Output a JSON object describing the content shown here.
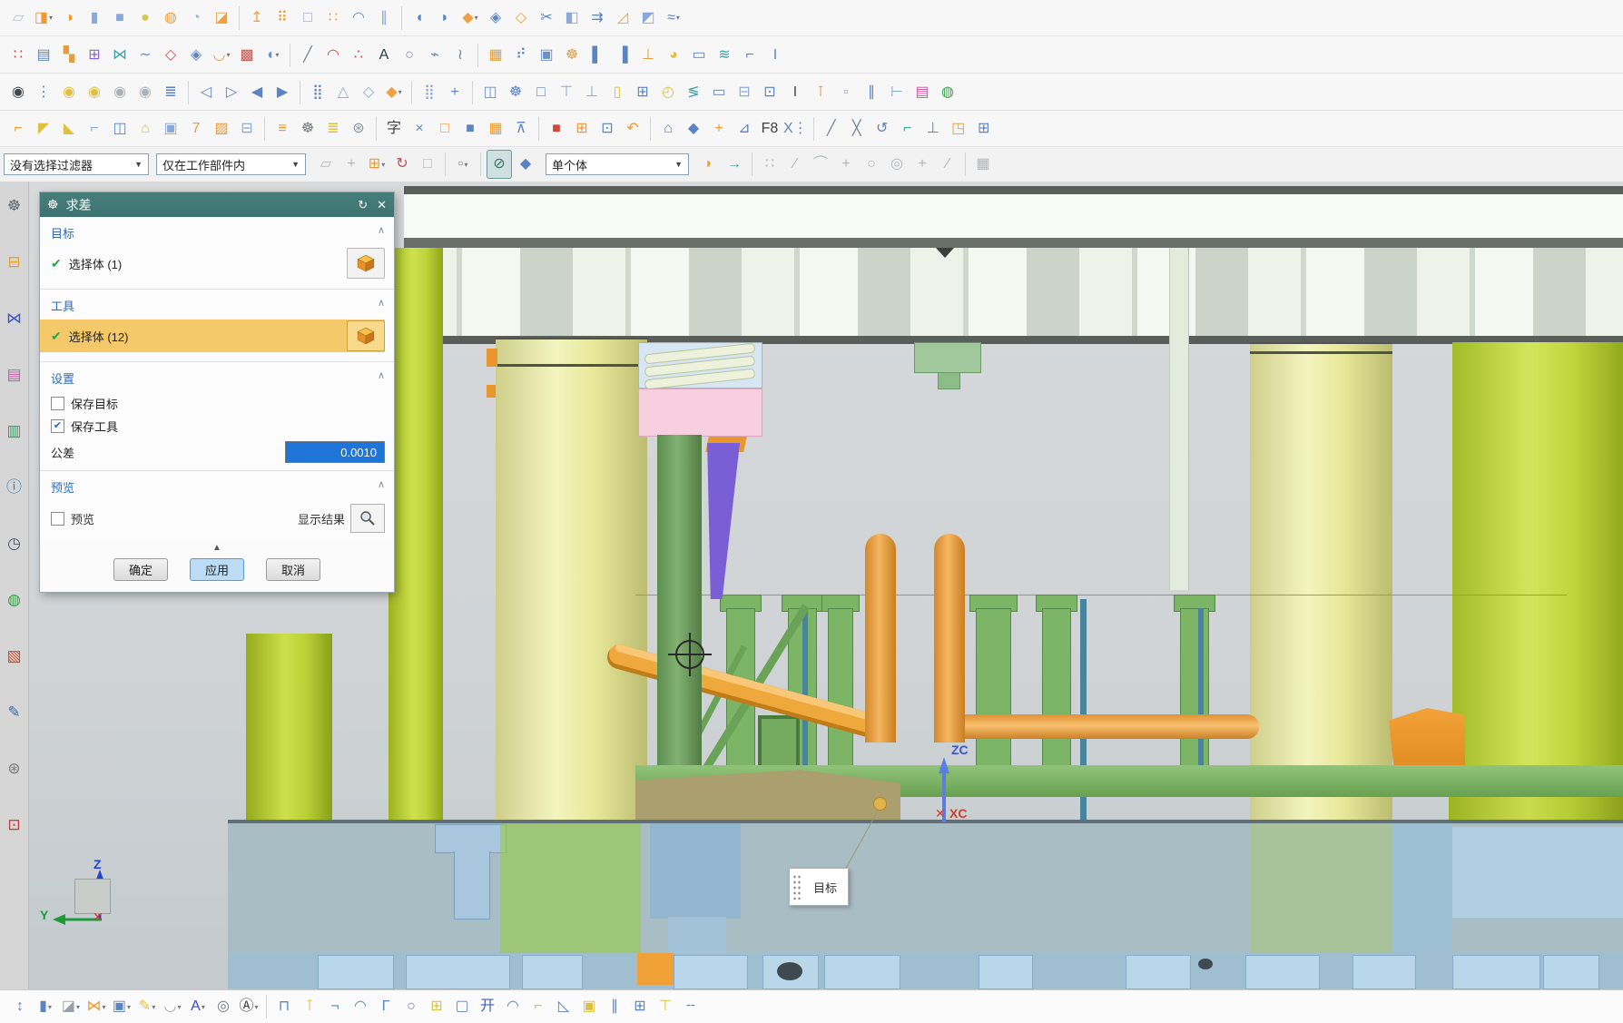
{
  "dialog": {
    "title": "求差",
    "target_section": {
      "label": "目标",
      "row_label": "选择体 (1)"
    },
    "tool_section": {
      "label": "工具",
      "row_label": "选择体 (12)"
    },
    "settings_section": {
      "label": "设置",
      "save_target_label": "保存目标",
      "save_target_checked": false,
      "save_tool_label": "保存工具",
      "save_tool_checked": true,
      "tolerance_label": "公差",
      "tolerance_value": "0.0010"
    },
    "preview_section": {
      "label": "预览",
      "preview_label": "预览",
      "preview_checked": false,
      "show_result_label": "显示结果"
    },
    "buttons": {
      "ok": "确定",
      "apply": "应用",
      "cancel": "取消"
    },
    "collapse_glyph": "▲"
  },
  "filter_bar": {
    "selection_filter": "没有选择过滤器",
    "scope": "仅在工作部件内",
    "body_rule": "单个体",
    "mid_icons": [
      [
        "ghost-select",
        "▱",
        "#b6bcc0"
      ],
      [
        "general-pick",
        "+",
        "#b0b6ba"
      ],
      [
        "point-snap",
        "⊞",
        "#e89a30",
        1
      ],
      [
        "rotate-pick",
        "↻",
        "#c05050"
      ],
      [
        "quick-pick",
        "□",
        "#b0b6ba"
      ],
      "|",
      [
        "marquee-select",
        "▫",
        "#8a9096",
        1
      ],
      "|",
      [
        "clip-section",
        "⊘",
        "#3f6a68",
        2
      ],
      [
        "shaded-body",
        "◆",
        "#5b84c4"
      ]
    ],
    "right_icons": [
      [
        "region-fan",
        "◗",
        "#f0a030"
      ],
      [
        "go-forward",
        "→",
        "#3fa0a8"
      ],
      "|",
      [
        "snap-point",
        "∷",
        "#b0b6ba"
      ],
      [
        "snap-end",
        "∕",
        "#b0b6ba"
      ],
      [
        "snap-mid",
        "⌒",
        "#b0b6ba"
      ],
      [
        "snap-cross",
        "+",
        "#b0b6ba"
      ],
      [
        "snap-circle",
        "○",
        "#b0b6ba"
      ],
      [
        "snap-center",
        "◎",
        "#b0b6ba"
      ],
      [
        "snap-plus",
        "+",
        "#b0b6ba"
      ],
      [
        "snap-slope",
        "∕",
        "#b0b6ba"
      ],
      "|",
      [
        "grid-snap",
        "▦",
        "#b0b6ba"
      ]
    ]
  },
  "toolbars": {
    "row1": [
      [
        "sketch",
        "▱",
        "#b8c4cc"
      ],
      [
        "extrude",
        "◨",
        "#f09a30",
        1
      ],
      [
        "revolve",
        "◑",
        "#f09a30"
      ],
      [
        "cylinder",
        "▮",
        "#8aa8d8"
      ],
      [
        "block",
        "■",
        "#8aa8d8"
      ],
      [
        "sphere",
        "●",
        "#d4c84e"
      ],
      [
        "boss",
        "◍",
        "#f0a040"
      ],
      [
        "pad",
        "◔",
        "#98b4dc"
      ],
      [
        "emboss",
        "◪",
        "#f0a040"
      ],
      "|",
      [
        "datum-plane",
        "↥",
        "#f0a040"
      ],
      [
        "pattern-feature",
        "⠿",
        "#f09a30"
      ],
      [
        "bounded-body",
        "□",
        "#8aa8d8"
      ],
      [
        "scatter-points",
        "∷",
        "#f09a30"
      ],
      [
        "swept",
        "◠",
        "#6a90cc"
      ],
      [
        "tube",
        "∥",
        "#8aa8d8"
      ],
      "|",
      [
        "page-left",
        "◖",
        "#5b84c4"
      ],
      [
        "page-right",
        "◗",
        "#5b84c4"
      ],
      [
        "unite",
        "◆",
        "#f0a040",
        1
      ],
      [
        "subtract-tool",
        "◈",
        "#5b84c4"
      ],
      [
        "intersect",
        "◇",
        "#f0a040"
      ],
      [
        "trim-body",
        "✂",
        "#5b84c4"
      ],
      [
        "split-body",
        "◧",
        "#8aa8d8"
      ],
      [
        "offset-face",
        "⇉",
        "#5b84c4"
      ],
      [
        "draft",
        "◿",
        "#f0a040"
      ],
      [
        "shell",
        "◩",
        "#8aa8d8"
      ],
      [
        "thread",
        "≈",
        "#5b84c4",
        1
      ]
    ],
    "row2": [
      [
        "mesh-points",
        "∷",
        "#d05048"
      ],
      [
        "pocket",
        "▤",
        "#5b84c4"
      ],
      [
        "pad-table",
        "▚",
        "#e0a040"
      ],
      [
        "datum-csys",
        "⊞",
        "#8868c8"
      ],
      [
        "mirror-geom",
        "⋈",
        "#3fa0a8"
      ],
      [
        "ruled",
        "∼",
        "#6a90cc"
      ],
      [
        "bounded-plane",
        "◇",
        "#d05048"
      ],
      [
        "curve-mesh",
        "◈",
        "#5b84c4"
      ],
      [
        "sew",
        "◡",
        "#e0a040",
        1
      ],
      [
        "patch-body",
        "▩",
        "#d05048"
      ],
      [
        "wrap-geom",
        "◖",
        "#6a90cc",
        1
      ],
      "|",
      [
        "line",
        "╱",
        "#708090"
      ],
      [
        "arc",
        "◠",
        "#d05048"
      ],
      [
        "point",
        "∴",
        "#d05048"
      ],
      [
        "text",
        "A",
        "#303848"
      ],
      [
        "ellipse",
        "○",
        "#6a90cc"
      ],
      [
        "helix",
        "⌁",
        "#5b84c4"
      ],
      [
        "law-curve",
        "≀",
        "#708090"
      ],
      "|",
      [
        "grid-pattern",
        "▦",
        "#e0a040"
      ],
      [
        "move-grid",
        "⠞",
        "#5b84c4"
      ],
      [
        "frame",
        "▣",
        "#6a90cc"
      ],
      [
        "gear-feature",
        "☸",
        "#e0a040"
      ],
      [
        "column-left",
        "▌",
        "#5b84c4"
      ],
      [
        "column-right",
        "▐",
        "#5b84c4"
      ],
      [
        "bolt-hole",
        "⊥",
        "#e0a040"
      ],
      [
        "pie-section",
        "◕",
        "#e0c040"
      ],
      [
        "slot",
        "▭",
        "#5b84c4"
      ],
      [
        "spring",
        "≋",
        "#3fa0a8"
      ],
      [
        "bracket",
        "⌐",
        "#5b84c4"
      ],
      [
        "i-beam",
        "I",
        "#5b84c4"
      ]
    ],
    "row3": [
      [
        "show-hide",
        "◉",
        "#404850"
      ],
      [
        "display-order",
        "⋮",
        "#5b84c4"
      ],
      [
        "highlight-on",
        "◉",
        "#e0c040"
      ],
      [
        "highlight-all",
        "◉",
        "#e0c040"
      ],
      [
        "dim-bulb",
        "◉",
        "#a8b0b8"
      ],
      [
        "dim-all",
        "◉",
        "#a8b0b8"
      ],
      [
        "layer-settings",
        "≣",
        "#5b84c4"
      ],
      "|",
      [
        "view-back",
        "◁",
        "#5b84c4"
      ],
      [
        "view-forward",
        "▷",
        "#5b84c4"
      ],
      [
        "view-first",
        "◀",
        "#5b84c4"
      ],
      [
        "view-last",
        "▶",
        "#5b84c4"
      ],
      "|",
      [
        "align-grid",
        "⣿",
        "#5b84c4"
      ],
      [
        "angle-snap",
        "△",
        "#8aa8d8"
      ],
      [
        "snap-open",
        "◇",
        "#8aa8d8"
      ],
      [
        "snap-solid",
        "◆",
        "#f0a040",
        1
      ],
      "|",
      [
        "point-grid",
        "⣿",
        "#8aa8d8"
      ],
      [
        "move-component",
        "+",
        "#5b84c4"
      ],
      "|",
      [
        "window-split",
        "◫",
        "#6a90cc"
      ],
      [
        "view-gear",
        "☸",
        "#5b84c4"
      ],
      [
        "fit-view",
        "□",
        "#5b84c4"
      ],
      [
        "top-align",
        "⊤",
        "#8aa8d8"
      ],
      [
        "bottom-align",
        "⊥",
        "#8aa8d8"
      ],
      [
        "cylinder-view",
        "▯",
        "#e0c040"
      ],
      [
        "table-view",
        "⊞",
        "#5b84c4"
      ],
      [
        "quadrant",
        "◴",
        "#e0c040"
      ],
      [
        "zigzag",
        "≶",
        "#3fa0a8"
      ],
      [
        "bar-note",
        "▭",
        "#5b84c4"
      ],
      [
        "equal-split",
        "⊟",
        "#8aa8d8"
      ],
      [
        "boxed",
        "⊡",
        "#5b84c4"
      ],
      [
        "italic-i",
        "I",
        "#404850"
      ],
      [
        "pin-top",
        "⊺",
        "#e0a040"
      ],
      [
        "small-square",
        "▫",
        "#8aa8d8"
      ],
      [
        "columns",
        "∥",
        "#5b84c4"
      ],
      [
        "tree-link",
        "⊢",
        "#8aa8d8"
      ],
      [
        "database",
        "▤",
        "#c858a8"
      ],
      [
        "globe-view",
        "◍",
        "#38a048"
      ]
    ],
    "row4": [
      [
        "corner-flange",
        "⌐",
        "#f09a30"
      ],
      [
        "finger-tab",
        "◤",
        "#e0c040"
      ],
      [
        "boot-tag",
        "◣",
        "#e0c040"
      ],
      [
        "pipe-corner",
        "⌐",
        "#8aa8d8"
      ],
      [
        "frame-pane",
        "◫",
        "#5b84c4"
      ],
      [
        "home-face",
        "⌂",
        "#e0c040"
      ],
      [
        "box-feature",
        "▣",
        "#8aa8d8"
      ],
      [
        "seven-form",
        "7",
        "#f09a30"
      ],
      [
        "hatch-area",
        "▨",
        "#f09a30"
      ],
      [
        "save-grid",
        "⊟",
        "#8aa8d8"
      ],
      "|",
      [
        "bar-wrench",
        "≡",
        "#f09a30"
      ],
      [
        "machine-gear",
        "☸",
        "#707880"
      ],
      [
        "comb-teeth",
        "≣",
        "#e0c040"
      ],
      [
        "spoke-wheel",
        "⊛",
        "#8898a8"
      ],
      "|",
      [
        "char-tool",
        "字",
        "#404040"
      ],
      [
        "curve-cross",
        "×",
        "#5b84c4"
      ],
      [
        "box-open",
        "□",
        "#f09a30"
      ],
      [
        "cube-solid",
        "■",
        "#5b84c4"
      ],
      [
        "grid-face",
        "▦",
        "#f09a30"
      ],
      [
        "broom-clean",
        "⊼",
        "#5b84c4"
      ],
      "|",
      [
        "red-cube",
        "■",
        "#d04838"
      ],
      [
        "frame-grid",
        "⊞",
        "#f09a30"
      ],
      [
        "screen-box",
        "⊡",
        "#5b84c4"
      ],
      [
        "flip-copy",
        "↶",
        "#f09a30"
      ],
      "|",
      [
        "pentagon-draft",
        "⌂",
        "#5b84c4"
      ],
      [
        "assembly-cube",
        "◆",
        "#5b84c4"
      ],
      [
        "cross-join",
        "+",
        "#f09a30"
      ],
      [
        "angle-graph",
        "⊿",
        "#5b84c4"
      ],
      [
        "f8-view",
        "F8",
        "#404040"
      ],
      [
        "x-list",
        "X⋮",
        "#5b84c4"
      ],
      "|",
      [
        "sketch-line",
        "╱",
        "#708090"
      ],
      [
        "sketch-x",
        "╳",
        "#708090"
      ],
      [
        "orbit-undo",
        "↺",
        "#5b84c4"
      ],
      [
        "elbow",
        "⌐",
        "#3fa0a8"
      ],
      [
        "tee-up",
        "⊥",
        "#5b84c4"
      ],
      [
        "corner-box",
        "◳",
        "#f09a30"
      ],
      [
        "final-grid",
        "⊞",
        "#5b84c4"
      ]
    ],
    "bottom": [
      [
        "measure-distance",
        "↕",
        "#5b84c4"
      ],
      [
        "measure-body",
        "▮",
        "#5b84c4",
        1
      ],
      [
        "stamp-face",
        "◪",
        "#9aa0a6",
        1
      ],
      [
        "bowtie-mate",
        "⋈",
        "#f09a30",
        1
      ],
      [
        "box-swirl",
        "▣",
        "#5b84c4",
        1
      ],
      [
        "edit-sketch",
        "✎",
        "#e0c040",
        1
      ],
      [
        "cup-section",
        "◡",
        "#9aa0a6",
        1
      ],
      [
        "font-style",
        "A",
        "#3a4ac8",
        1
      ],
      [
        "find-text",
        "◎",
        "#707880"
      ],
      [
        "rotate-text",
        "Ⓐ",
        "#404040",
        1
      ],
      "|",
      [
        "clamp-u",
        "⊓",
        "#5b84c4"
      ],
      [
        "pin-joint",
        "⊺",
        "#e0c040"
      ],
      [
        "hook-turn",
        "¬",
        "#5b84c4"
      ],
      [
        "arch-top",
        "◠",
        "#5b84c4"
      ],
      [
        "corner-gamma",
        "Γ",
        "#5b84c4"
      ],
      [
        "balloon-note",
        "○",
        "#5b84c4"
      ],
      [
        "square-flag",
        "⊞",
        "#e0c040"
      ],
      [
        "rounded-rect",
        "▢",
        "#5b84c4"
      ],
      [
        "kai-symbol",
        "开",
        "#4060c0"
      ],
      [
        "dome",
        "◠",
        "#5b84c4"
      ],
      [
        "angle-left",
        "⌐",
        "#e0c040"
      ],
      [
        "slope-tri",
        "◺",
        "#5b84c4"
      ],
      [
        "block-fill",
        "▣",
        "#e0c040"
      ],
      [
        "twin-columns",
        "∥",
        "#5b84c4"
      ],
      [
        "grid-cells",
        "⊞",
        "#5b84c4"
      ],
      [
        "tee-top",
        "⊤",
        "#e0c040"
      ],
      [
        "dash-line",
        "╌",
        "#5b84c4"
      ]
    ],
    "left": [
      [
        "roles",
        "☸",
        "#5a6a72"
      ],
      [
        "assembly-navigator",
        "⊟",
        "#e8a030"
      ],
      [
        "constraint-navigator",
        "⋈",
        "#3858c8"
      ],
      [
        "part-navigator",
        "▤",
        "#c858a8"
      ],
      [
        "reuse-library",
        "▥",
        "#30a060"
      ],
      [
        "web-browser",
        "ⓘ",
        "#2878d8"
      ],
      [
        "history",
        "◷",
        "#405878"
      ],
      [
        "process-studio",
        "◍",
        "#38a048"
      ],
      [
        "color-palette",
        "▧",
        "#d84820"
      ],
      [
        "visual-reports",
        "✎",
        "#3868b8"
      ],
      [
        "system-tools",
        "⊛",
        "#787878"
      ],
      [
        "window-image",
        "⊡",
        "#c83838"
      ]
    ]
  },
  "viewport": {
    "tooltip": "目标",
    "labels": {
      "zc": "ZC",
      "xc": "XC",
      "z": "Z",
      "y": "Y",
      "x_marker": "✕"
    }
  },
  "colors": {
    "dialog_header": "#427876",
    "highlight_row": "#f5c869",
    "tolerance_selection": "#1f74d8",
    "chartreuse": "#c3d838",
    "pale_yellow": "#ececa4",
    "dark_green": "#6f9f60",
    "orange": "#f0a040",
    "pink": "#f8cfdf",
    "purple": "#7a5ed6",
    "plate_blue": "#a8bdc4"
  }
}
